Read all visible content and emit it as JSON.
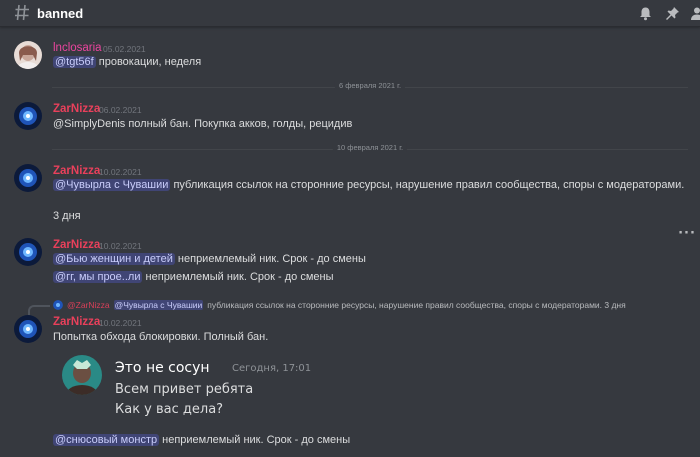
{
  "header": {
    "channel_name": "banned",
    "icons": [
      "hash-icon",
      "bell-icon",
      "pin-icon",
      "members-icon"
    ]
  },
  "dividers": [
    "6 февраля 2021 г.",
    "10 февраля 2021 г."
  ],
  "messages": [
    {
      "author": "lnclosaria",
      "time": "05.02.2021",
      "mention": "@tgt56f",
      "text": " провокации, неделя"
    },
    {
      "author": "ZarNizza",
      "time": "06.02.2021",
      "text": "@SimplyDenis полный бан. Покупка акков, голды, рецидив"
    },
    {
      "author": "ZarNizza",
      "time": "10.02.2021",
      "mention": "@Чувырла с Чувашии",
      "text": " публикация ссылок на сторонние ресурсы, нарушение правил сообщества, споры с модераторами.",
      "text2": "3 дня"
    },
    {
      "author": "ZarNizza",
      "time": "10.02.2021",
      "mention": "@Бью женщин и детей",
      "text": " неприемлемый ник. Срок - до смены",
      "mention2": "@гг, мы прое..ли",
      "text2": " неприемлемый ник. Срок - до смены"
    },
    {
      "reply": {
        "author": "@ZarNizza",
        "mention": "@Чувырла с Чувашии",
        "text": "публикация ссылок на сторонние ресурсы, нарушение правил сообщества, споры с модераторами.  3 дня"
      },
      "author": "ZarNizza",
      "time": "10.02.2021",
      "text": "Попытка обхода блокировки. Полный бан.",
      "embed": {
        "name": "Это не сосун",
        "time": "Сегодня, 17:01",
        "line1": "Всем привет ребята",
        "line2": "Как у вас дела?"
      },
      "mention2": "@снюсовый монстр",
      "text2": " неприемлемый ник. Срок - до смены"
    }
  ],
  "more_label": "···",
  "colors": {
    "background": "#36393f",
    "author_red": "#e9405b",
    "author_pink": "#eb459e",
    "mention_bg": "#4c5391",
    "muted": "#72767d"
  }
}
